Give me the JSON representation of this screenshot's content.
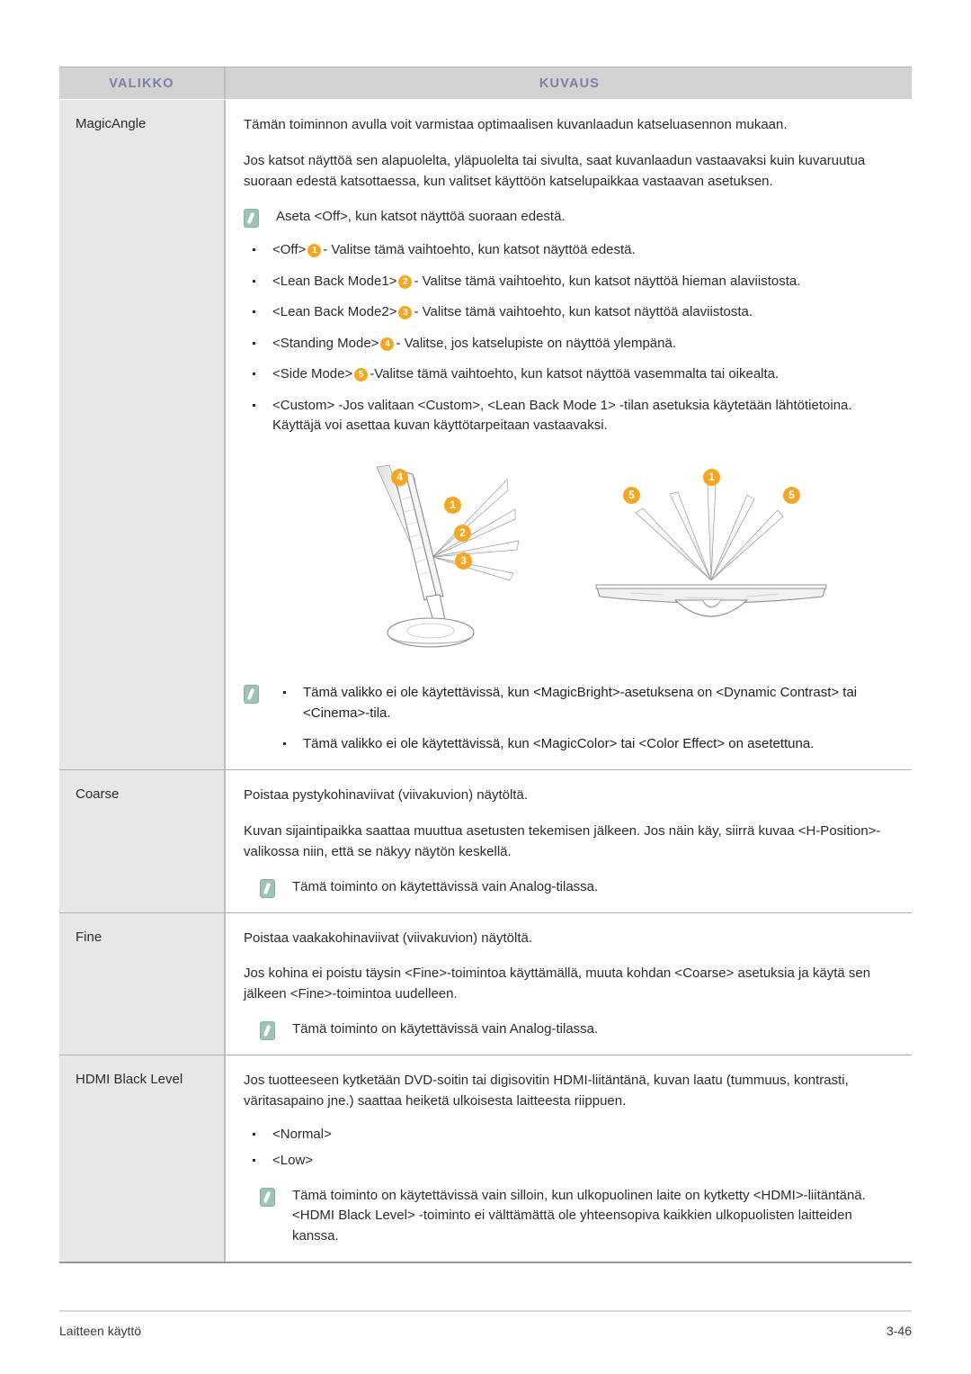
{
  "table": {
    "headers": {
      "menu": "VALIKKO",
      "description": "KUVAUS"
    },
    "accent_color": "#7b7fa8",
    "badge_color": "#f5a623",
    "note_icon_color": "#9ec4b4",
    "rows": [
      {
        "menu": "MagicAngle",
        "paragraphs": [
          "Tämän toiminnon avulla voit varmistaa optimaalisen kuvanlaadun katseluasennon mukaan.",
          "Jos katsot näyttöä sen alapuolelta, yläpuolelta tai sivulta, saat kuvanlaadun vastaavaksi kuin kuvaruutua suoraan edestä katsottaessa, kun valitset käyttöön katselupaikkaa vastaavan asetuksen."
        ],
        "note_top": "Aseta <Off>, kun katsot näyttöä suoraan edestä.",
        "options": [
          {
            "name": "<Off>",
            "badge": "1",
            "text": "- Valitse tämä vaihtoehto, kun katsot näyttöä edestä."
          },
          {
            "name": "<Lean Back Mode1>",
            "badge": "2",
            "text": "- Valitse tämä vaihtoehto, kun katsot näyttöä hieman alaviistosta."
          },
          {
            "name": "<Lean Back Mode2>",
            "badge": "3",
            "text": "- Valitse tämä vaihtoehto, kun katsot näyttöä alaviistosta."
          },
          {
            "name": "<Standing Mode>",
            "badge": "4",
            "text": "- Valitse, jos katselupiste on näyttöä ylempänä."
          },
          {
            "name": "<Side Mode>",
            "badge": "5",
            "text": "-Valitse tämä vaihtoehto, kun katsot näyttöä vasemmalta tai oikealta."
          },
          {
            "name": "<Custom>",
            "badge": "",
            "text": "-Jos valitaan <Custom>, <Lean Back Mode 1> -tilan asetuksia käytetään lähtötietoina. Käyttäjä voi asettaa kuvan käyttötarpeitaan vastaavaksi."
          }
        ],
        "illustration": {
          "left_view_badges": [
            "4",
            "1",
            "2",
            "3"
          ],
          "right_view_badges": [
            "5",
            "1",
            "5"
          ]
        },
        "note_bottom_items": [
          "Tämä valikko ei ole käytettävissä, kun <MagicBright>-asetuksena on <Dynamic Contrast> tai <Cinema>-tila.",
          "Tämä valikko ei ole käytettävissä, kun <MagicColor> tai <Color Effect> on asetettuna."
        ]
      },
      {
        "menu": "Coarse",
        "paragraphs": [
          "Poistaa pystykohinaviivat (viivakuvion) näytöltä.",
          "Kuvan sijaintipaikka saattaa muuttua asetusten tekemisen jälkeen. Jos näin käy, siirrä kuvaa <H-Position>-valikossa niin, että se näkyy näytön keskellä."
        ],
        "note": "Tämä toiminto on käytettävissä vain Analog-tilassa."
      },
      {
        "menu": "Fine",
        "paragraphs": [
          "Poistaa vaakakohinaviivat (viivakuvion) näytöltä.",
          "Jos kohina ei poistu täysin <Fine>-toimintoa käyttämällä, muuta kohdan <Coarse> asetuksia ja käytä sen jälkeen <Fine>-toimintoa uudelleen."
        ],
        "note": "Tämä toiminto on käytettävissä vain Analog-tilassa."
      },
      {
        "menu": "HDMI Black Level",
        "paragraphs": [
          "Jos tuotteeseen kytketään DVD-soitin tai digisovitin HDMI-liitäntänä, kuvan laatu (tummuus, kontrasti, väritasapaino jne.) saattaa heiketä ulkoisesta laitteesta riippuen."
        ],
        "options": [
          {
            "name": "<Normal>",
            "badge": "",
            "text": ""
          },
          {
            "name": "<Low>",
            "badge": "",
            "text": ""
          }
        ],
        "note": "Tämä toiminto on käytettävissä vain silloin, kun ulkopuolinen laite on kytketty <HDMI>-liitäntänä. <HDMI Black Level> -toiminto ei välttämättä ole yhteensopiva kaikkien ulkopuolisten laitteiden kanssa."
      }
    ]
  },
  "footer": {
    "left": "Laitteen käyttö",
    "right": "3-46"
  }
}
